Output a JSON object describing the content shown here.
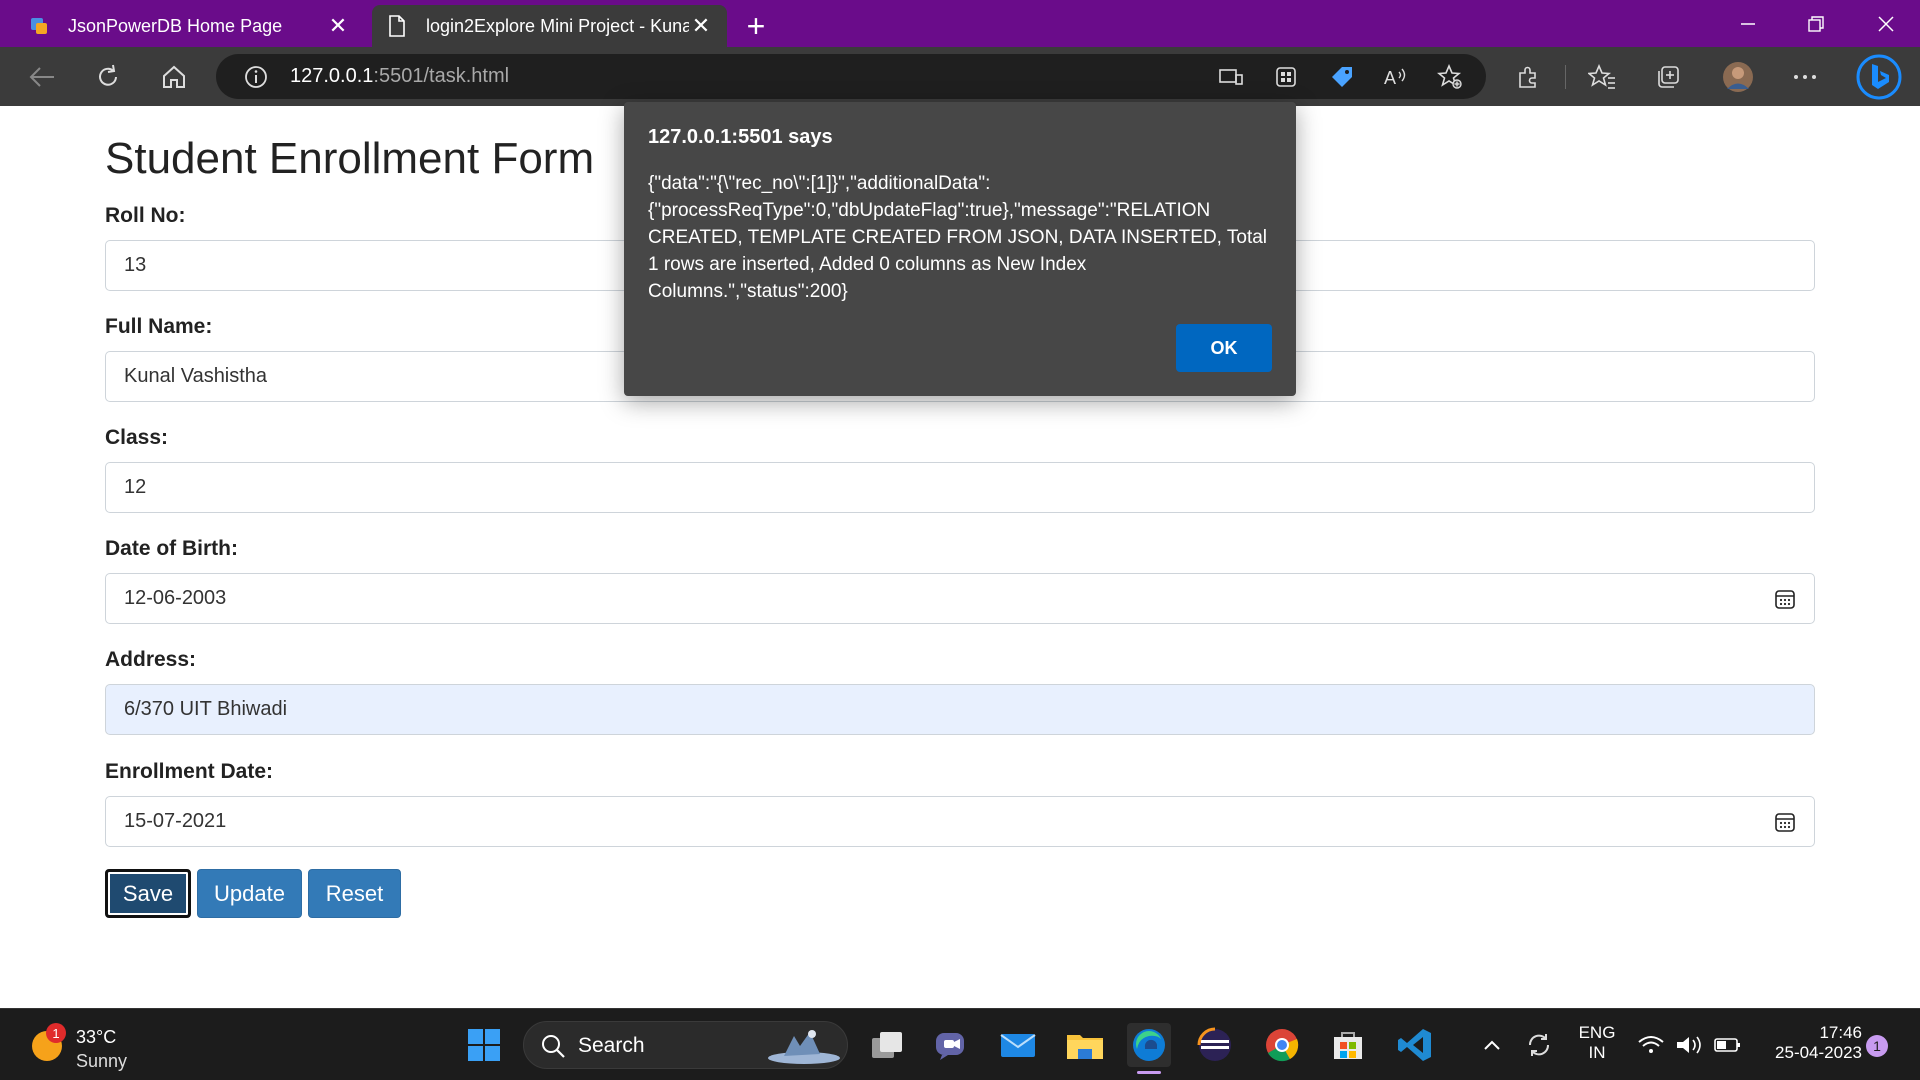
{
  "browser": {
    "tabs": [
      {
        "label": "JsonPowerDB Home Page",
        "active": false
      },
      {
        "label": "login2Explore Mini Project - Kuna",
        "active": true
      }
    ],
    "url_host": "127.0.0.1",
    "url_rest": ":5501/task.html"
  },
  "form": {
    "title": "Student Enrollment Form",
    "fields": [
      {
        "label": "Roll No:",
        "value": "13"
      },
      {
        "label": "Full Name:",
        "value": "Kunal Vashistha"
      },
      {
        "label": "Class:",
        "value": "12"
      },
      {
        "label": "Date of Birth:",
        "value": "12-06-2003"
      },
      {
        "label": "Address:",
        "value": "6/370 UIT Bhiwadi"
      },
      {
        "label": "Enrollment Date:",
        "value": "15-07-2021"
      }
    ],
    "buttons": {
      "save": "Save",
      "update": "Update",
      "reset": "Reset"
    }
  },
  "dialog": {
    "title": "127.0.0.1:5501 says",
    "message": "{\"data\":\"{\\\"rec_no\\\":[1]}\",\"additionalData\":{\"processReqType\":0,\"dbUpdateFlag\":true},\"message\":\"RELATION CREATED, TEMPLATE CREATED FROM JSON, DATA INSERTED, Total 1 rows are inserted, Added 0 columns as New Index Columns.\",\"status\":200}",
    "ok_label": "OK"
  },
  "taskbar": {
    "weather_temp": "33°C",
    "weather_cond": "Sunny",
    "weather_badge": "1",
    "search_label": "Search",
    "lang_line1": "ENG",
    "lang_line2": "IN",
    "time": "17:46",
    "date": "25-04-2023",
    "notif_count": "1"
  },
  "colors": {
    "titlebar": "#6a0c8a",
    "toolbar": "#3b3b3b",
    "button_primary": "#337ab7",
    "dialog_bg": "#474747",
    "dialog_ok": "#0067c0"
  }
}
